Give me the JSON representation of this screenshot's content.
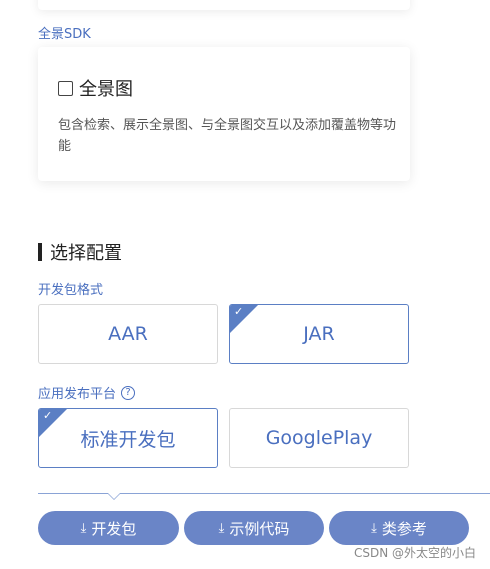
{
  "sdk_section": {
    "label": "全景SDK",
    "card_title": "全景图",
    "card_desc": "包含检索、展示全景图、与全景图交互以及添加覆盖物等功能"
  },
  "config": {
    "heading": "选择配置",
    "format_label": "开发包格式",
    "formats": [
      {
        "label": "AAR",
        "selected": false
      },
      {
        "label": "JAR",
        "selected": true
      }
    ],
    "platform_label": "应用发布平台",
    "help_glyph": "?",
    "platforms": [
      {
        "label": "标准开发包",
        "selected": true
      },
      {
        "label": "GooglePlay",
        "selected": false
      }
    ]
  },
  "actions": {
    "download_glyph": "⤓",
    "dev_package": "开发包",
    "sample_code": "示例代码",
    "reference": "类参考"
  },
  "watermark": "CSDN @外太空的小白",
  "colors": {
    "accent": "#5b7fc4",
    "button": "#6a85c7",
    "link": "#4a6fbf"
  }
}
